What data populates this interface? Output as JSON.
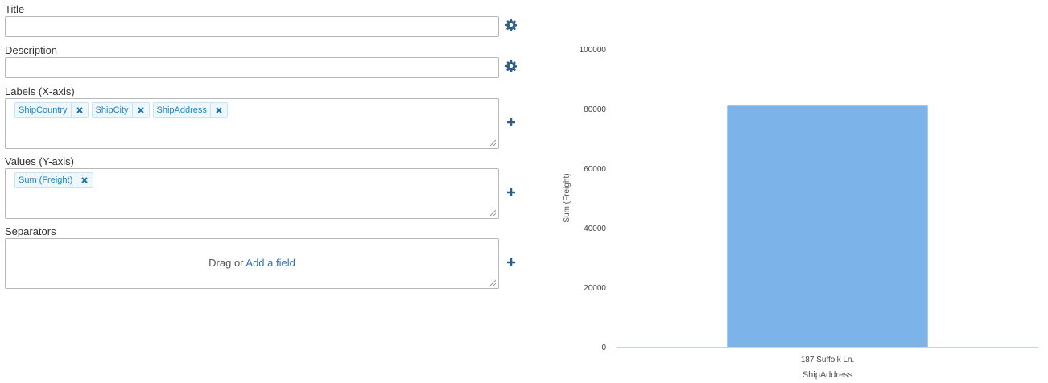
{
  "form": {
    "title": {
      "label": "Title",
      "value": "",
      "icon": "gear-icon"
    },
    "description": {
      "label": "Description",
      "value": "",
      "icon": "gear-icon"
    },
    "labels": {
      "label": "Labels (X-axis)",
      "chips": [
        "ShipCountry",
        "ShipCity",
        "ShipAddress"
      ],
      "icon": "plus-icon"
    },
    "values": {
      "label": "Values (Y-axis)",
      "chips": [
        "Sum (Freight)"
      ],
      "icon": "plus-icon"
    },
    "separators": {
      "label": "Separators",
      "drop_text": "Drag or ",
      "drop_link": "Add a field",
      "icon": "plus-icon"
    }
  },
  "colors": {
    "accent": "#2e5f8a",
    "chip_text": "#1f83c1",
    "bar": "#7cb4ea"
  },
  "chart_data": {
    "type": "bar",
    "categories": [
      "187 Suffolk Ln."
    ],
    "values": [
      81000
    ],
    "xlabel": "ShipAddress",
    "ylabel": "Sum (Freight)",
    "ylim": [
      0,
      100000
    ],
    "yticks": [
      "0",
      "20000",
      "40000",
      "60000",
      "80000",
      "100000"
    ],
    "grid": false,
    "legend": "none"
  }
}
